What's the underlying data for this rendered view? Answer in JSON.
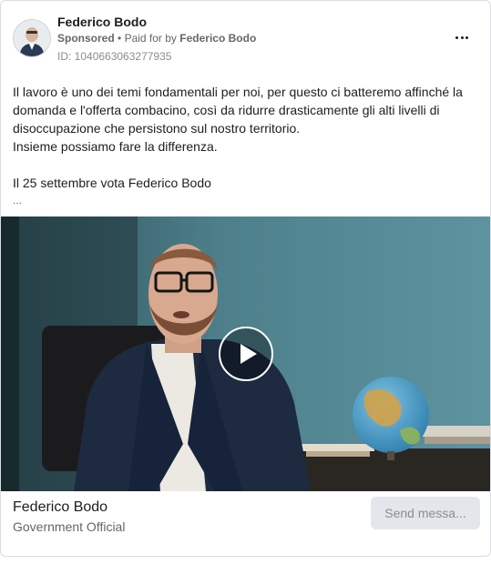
{
  "post": {
    "page_name": "Federico Bodo",
    "sponsored_label": "Sponsored",
    "separator": "•",
    "paid_for_prefix": "Paid for by",
    "paid_for_name": "Federico Bodo",
    "ad_id": "ID: 1040663063277935",
    "more_icon": "more-horizontal-icon"
  },
  "text": {
    "paragraph1": "Il lavoro è uno dei temi fondamentali per noi, per questo ci batteremo affinché la domanda e l'offerta combacino, così da ridurre drasticamente gli alti livelli di disoccupazione che persistono sul nostro territorio.",
    "paragraph2": "Insieme possiamo fare la differenza.",
    "paragraph3": "Il 25 settembre vota Federico Bodo",
    "ellipsis": "..."
  },
  "media": {
    "type": "video",
    "play_icon": "play-icon"
  },
  "footer": {
    "name": "Federico Bodo",
    "category": "Government Official",
    "cta_label": "Send messa..."
  },
  "colors": {
    "text_primary": "#1c1e21",
    "text_secondary": "#65676b",
    "cta_background": "#e4e6eb",
    "border": "#dadde1"
  }
}
